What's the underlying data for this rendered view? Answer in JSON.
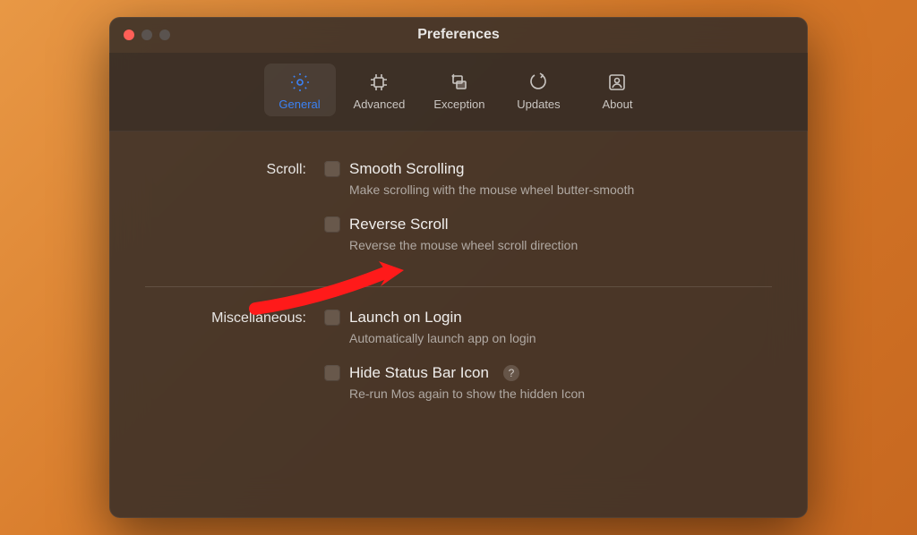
{
  "window": {
    "title": "Preferences"
  },
  "tabs": [
    {
      "label": "General"
    },
    {
      "label": "Advanced"
    },
    {
      "label": "Exception"
    },
    {
      "label": "Updates"
    },
    {
      "label": "About"
    }
  ],
  "sections": {
    "scroll": {
      "label": "Scroll:",
      "options": [
        {
          "title": "Smooth Scrolling",
          "desc": "Make scrolling with the mouse wheel butter-smooth"
        },
        {
          "title": "Reverse Scroll",
          "desc": "Reverse the mouse wheel scroll direction"
        }
      ]
    },
    "misc": {
      "label": "Miscellaneous:",
      "options": [
        {
          "title": "Launch on Login",
          "desc": "Automatically launch app on login"
        },
        {
          "title": "Hide Status Bar Icon",
          "desc": "Re-run Mos again to show the hidden Icon"
        }
      ]
    }
  },
  "help_glyph": "?"
}
